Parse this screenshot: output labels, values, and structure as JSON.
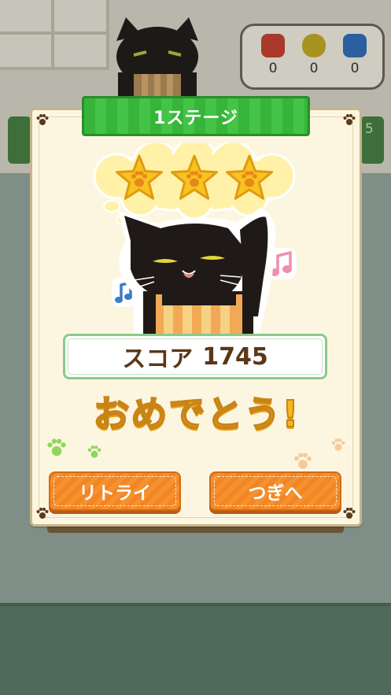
{
  "background": {
    "item_counts": [
      "0",
      "0",
      "0"
    ],
    "side_right_number": "5"
  },
  "dialog": {
    "stage_title": "1ステージ",
    "stars_earned": 3,
    "stars_total": 3,
    "score_label": "スコア",
    "score_value": "1745",
    "congrats_text": "おめでとう!",
    "retry_label": "リトライ",
    "next_label": "つぎへ"
  },
  "colors": {
    "banner_green": "#3cbc3f",
    "button_orange": "#f28a28",
    "congrats_yellow": "#f5b71e",
    "panel_cream": "#fcf6e1",
    "score_border": "#8cc98b"
  }
}
